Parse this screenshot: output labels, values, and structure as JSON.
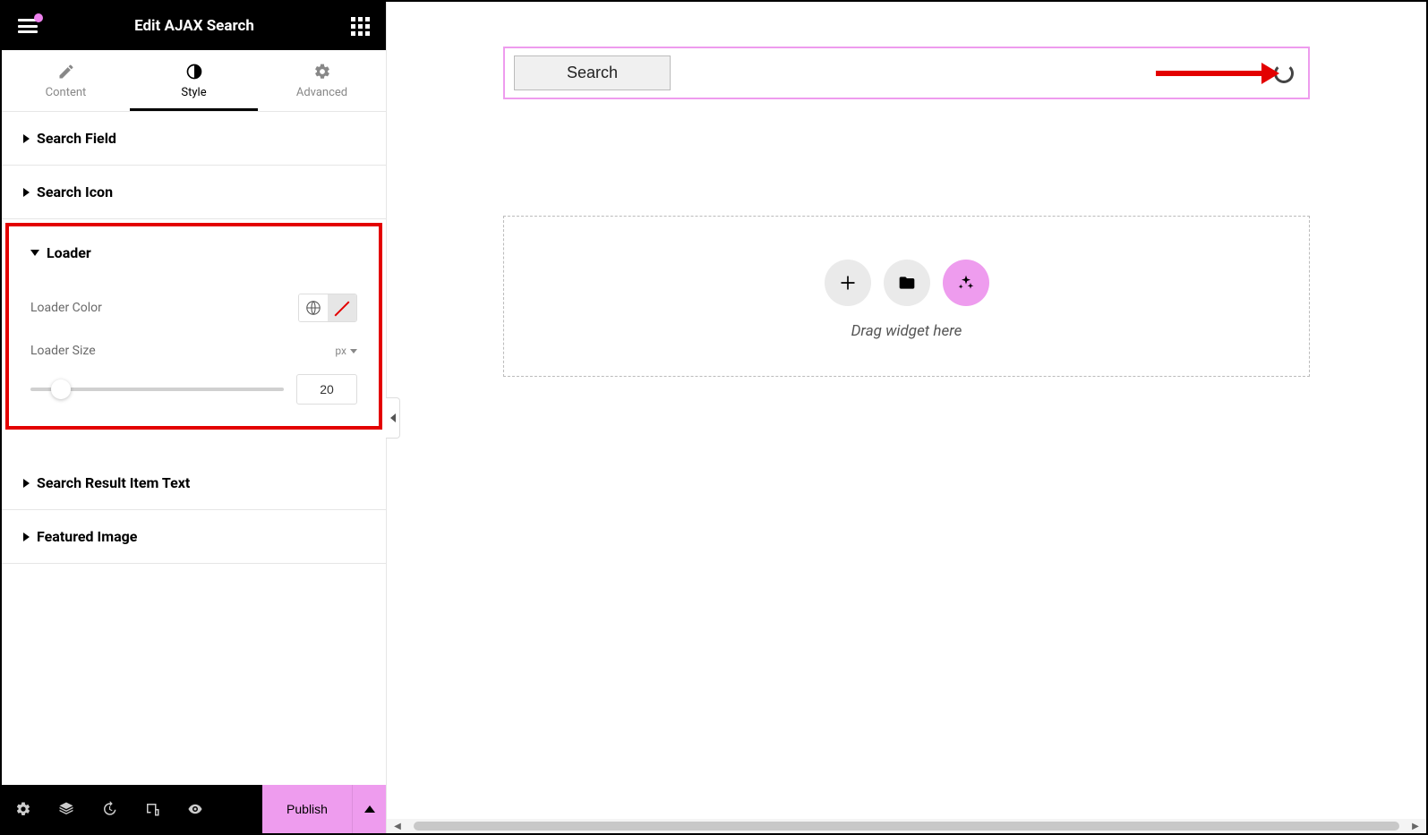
{
  "header": {
    "title": "Edit AJAX Search"
  },
  "tabs": {
    "content": "Content",
    "style": "Style",
    "advanced": "Advanced"
  },
  "sections": {
    "search_field": "Search Field",
    "search_icon": "Search Icon",
    "loader": "Loader",
    "loader_color_label": "Loader Color",
    "loader_size_label": "Loader Size",
    "loader_size_unit": "px",
    "loader_size_value": "20",
    "result_item_text": "Search Result Item Text",
    "featured_image": "Featured Image"
  },
  "footer": {
    "publish": "Publish"
  },
  "canvas": {
    "search_button_label": "Search",
    "drag_hint": "Drag widget here"
  }
}
